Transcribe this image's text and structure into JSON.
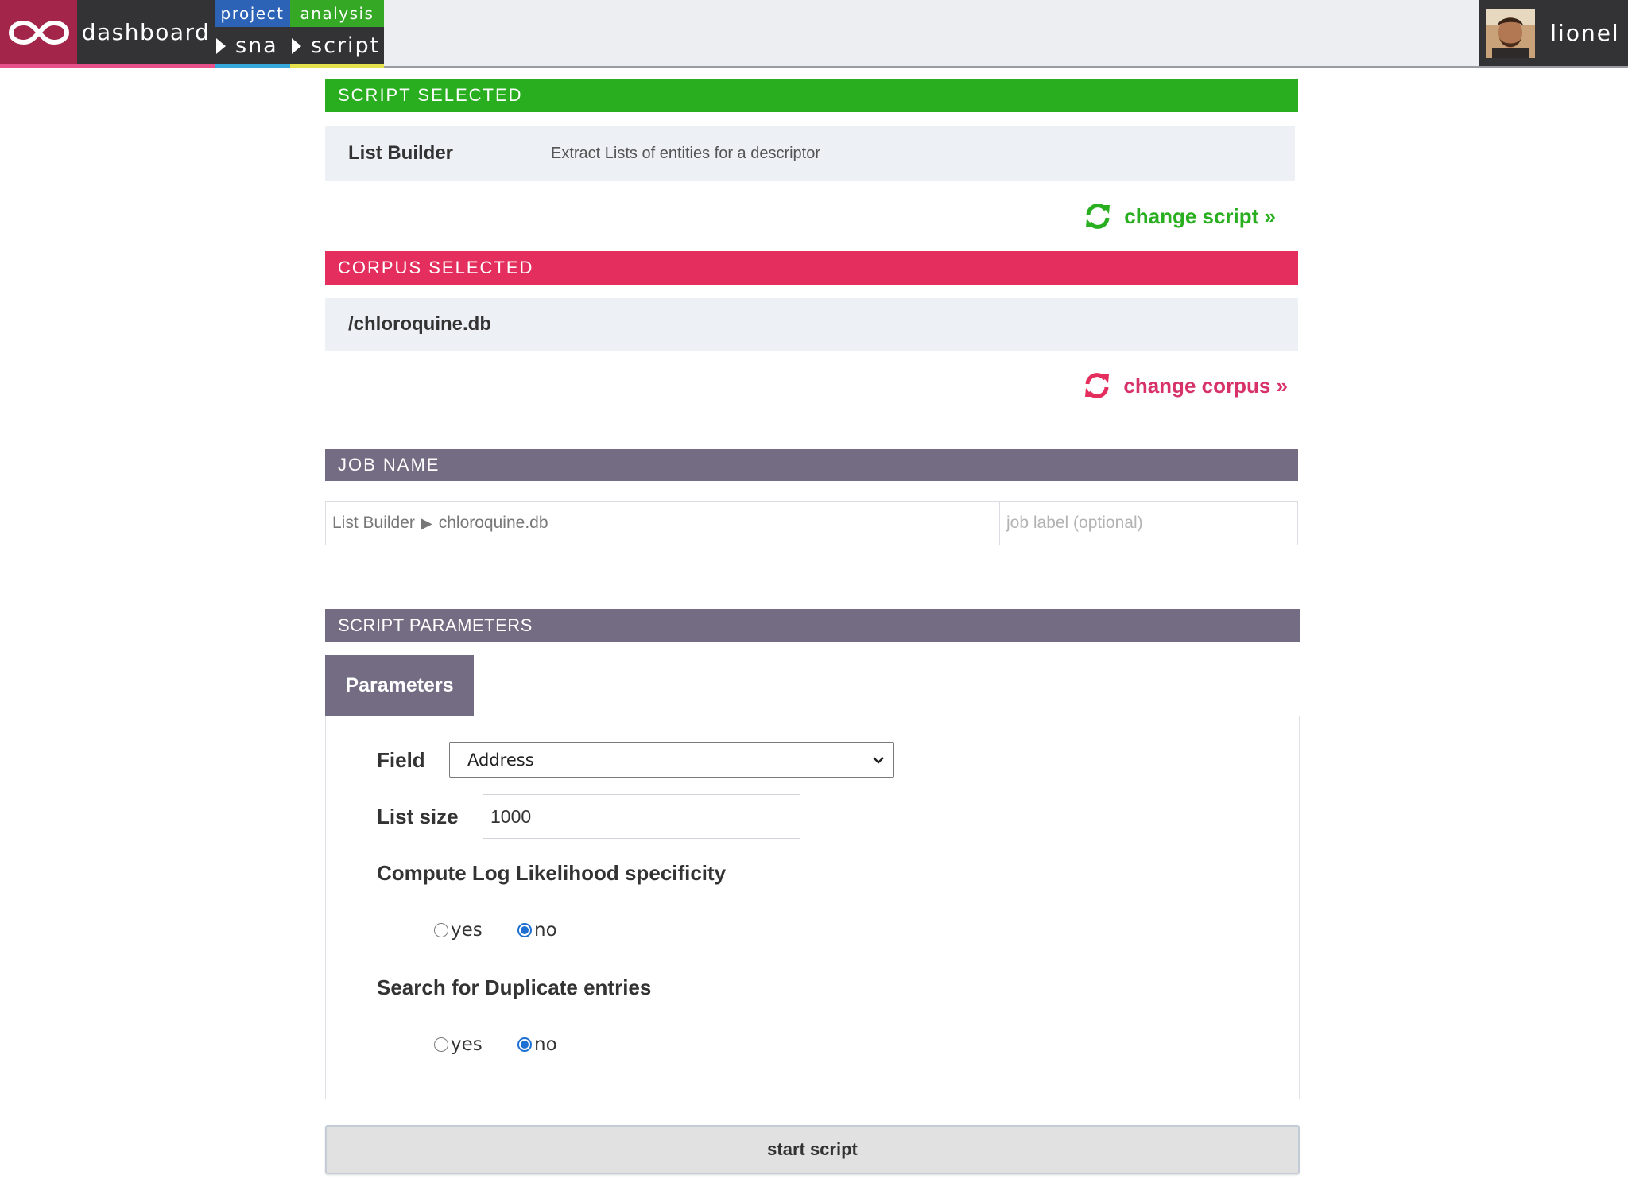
{
  "nav": {
    "dashboard": "dashboard",
    "crumbs": [
      {
        "category": "project",
        "label": "sna"
      },
      {
        "category": "analysis",
        "label": "script"
      }
    ],
    "user": "lionel",
    "icons": {
      "logo": "infinity-logo",
      "avatar": "user-avatar"
    }
  },
  "script_section": {
    "title": "SCRIPT SELECTED",
    "name": "List Builder",
    "description": "Extract Lists of entities for a descriptor",
    "change_link": "change script »"
  },
  "corpus_section": {
    "title": "CORPUS SELECTED",
    "name": "/chloroquine.db",
    "change_link": "change corpus »"
  },
  "job_section": {
    "title": "JOB NAME",
    "default_script": "List Builder",
    "separator": "▶",
    "default_corpus": "chloroquine.db",
    "label_placeholder": "job label (optional)"
  },
  "params_section": {
    "title": "SCRIPT PARAMETERS",
    "tab": "Parameters",
    "field_label": "Field",
    "field_value": "Address",
    "list_size_label": "List size",
    "list_size_value": "1000",
    "loglik_label": "Compute Log Likelihood specificity",
    "loglik_options": [
      "yes",
      "no"
    ],
    "loglik_selected": "no",
    "duplicates_label": "Search for Duplicate entries",
    "duplicates_options": [
      "yes",
      "no"
    ],
    "duplicates_selected": "no"
  },
  "start_button": "start script",
  "colors": {
    "script_green": "#29ae1f",
    "corpus_red": "#e42e5e",
    "section_grey": "#736c83",
    "radio_blue": "#1d6fd1"
  }
}
